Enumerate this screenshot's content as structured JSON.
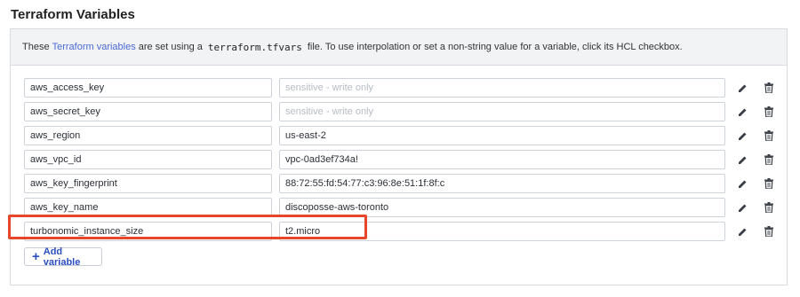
{
  "page": {
    "title": "Terraform Variables"
  },
  "info": {
    "prefix": "These",
    "link": "Terraform variables",
    "middle": "are set using a",
    "code": "terraform.tfvars",
    "suffix": "file. To use interpolation or set a non-string value for a variable, click its HCL checkbox."
  },
  "variables": [
    {
      "key": "aws_access_key",
      "value": "",
      "placeholder": "sensitive - write only"
    },
    {
      "key": "aws_secret_key",
      "value": "",
      "placeholder": "sensitive - write only"
    },
    {
      "key": "aws_region",
      "value": "us-east-2",
      "placeholder": ""
    },
    {
      "key": "aws_vpc_id",
      "value": "vpc-0ad3ef734a!",
      "placeholder": ""
    },
    {
      "key": "aws_key_fingerprint",
      "value": "88:72:55:fd:54:77:c3:96:8e:51:1f:8f:c",
      "placeholder": ""
    },
    {
      "key": "aws_key_name",
      "value": "discoposse-aws-toronto",
      "placeholder": ""
    },
    {
      "key": "turbonomic_instance_size",
      "value": "t2.micro",
      "placeholder": ""
    }
  ],
  "add_button": {
    "icon": "plus-icon",
    "label": "Add variable"
  },
  "icons": {
    "edit": "pencil-icon",
    "delete": "trash-icon"
  },
  "colors": {
    "link": "#4a6ad4",
    "button_text": "#2c4fc0",
    "highlight": "#e8462a"
  }
}
